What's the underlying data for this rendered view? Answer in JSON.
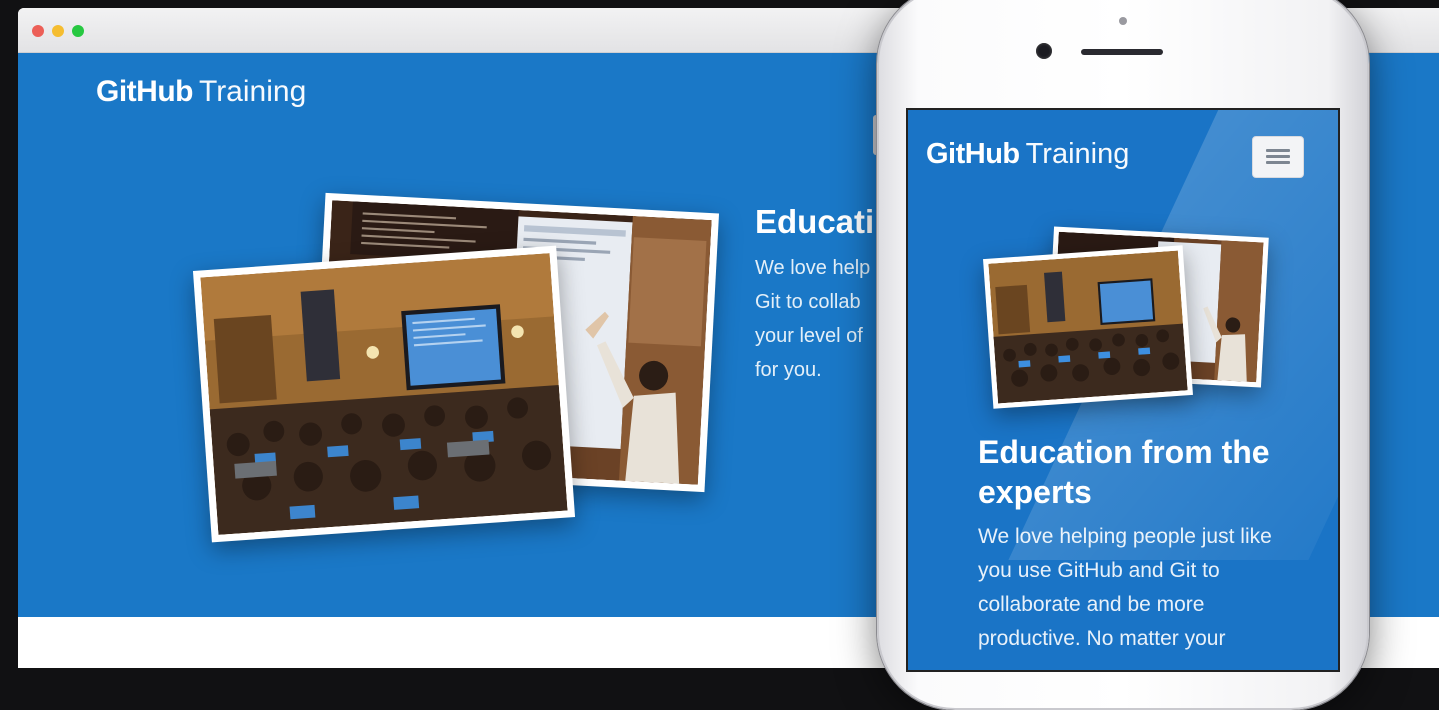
{
  "window": {
    "controls": [
      "close",
      "minimize",
      "maximize"
    ]
  },
  "desktop": {
    "logo": {
      "brand": "GitHub",
      "product": "Training"
    },
    "hero_heading": "Educati",
    "hero_text_lines": [
      "We love help",
      "Git to collab",
      "your level of",
      "for you."
    ]
  },
  "mobile": {
    "logo": {
      "brand": "GitHub",
      "product": "Training"
    },
    "menu_icon": "hamburger-icon",
    "hero_heading": "Education from the experts",
    "hero_text": "We love helping people just like you use GitHub and Git to collaborate and be more productive. No matter your"
  },
  "colors": {
    "hero_blue": "#1a78c7",
    "text_white": "#ffffff",
    "menu_button_bg": "#f3f4f6"
  }
}
